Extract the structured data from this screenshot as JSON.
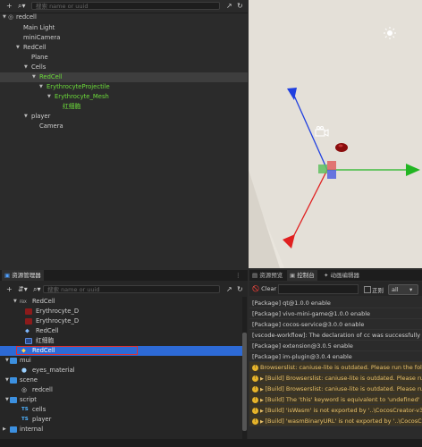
{
  "hierarchy": {
    "search_placeholder": "搜索 name or uuid",
    "add_label": "+",
    "items": [
      {
        "label": "redcell"
      },
      {
        "label": "Main Light"
      },
      {
        "label": "miniCamera"
      },
      {
        "label": "RedCell"
      },
      {
        "label": "Plane"
      },
      {
        "label": "Cells"
      },
      {
        "label": "RedCell"
      },
      {
        "label": "ErythrocyteProjectile"
      },
      {
        "label": "Erythrocyte_Mesh"
      },
      {
        "label": "红细胞"
      },
      {
        "label": "player"
      },
      {
        "label": "Camera"
      }
    ]
  },
  "assets": {
    "tab_title": "资源管理器",
    "search_placeholder": "搜索 name or uuid",
    "items": [
      {
        "label": "RedCell"
      },
      {
        "label": "Erythrocyte_D"
      },
      {
        "label": "Erythrocyte_D"
      },
      {
        "label": "RedCell"
      },
      {
        "label": "红细胞"
      },
      {
        "label": "RedCell"
      },
      {
        "label": "mui"
      },
      {
        "label": "eyes_material"
      },
      {
        "label": "scene"
      },
      {
        "label": "redcell"
      },
      {
        "label": "script"
      },
      {
        "label": "cells"
      },
      {
        "label": "player"
      },
      {
        "label": "internal"
      }
    ],
    "ts_badge": "TS"
  },
  "console": {
    "tabs": [
      "资源预览",
      "控制台",
      "动画编辑器"
    ],
    "clear_label": "Clear",
    "regex_label": "正则",
    "filter_value": "all",
    "lines": [
      {
        "text": "[Package] qt@1.0.0 enable",
        "level": "info"
      },
      {
        "text": "[Package] vivo-mini-game@1.0.0 enable",
        "level": "info"
      },
      {
        "text": "[Package] cocos-service@3.0.0 enable",
        "level": "info"
      },
      {
        "text": "[vscode-workflow]: The declaration of cc was successfully updated",
        "level": "info"
      },
      {
        "text": "[Package] extension@3.0.5 enable",
        "level": "info"
      },
      {
        "text": "[Package] im-plugin@3.0.4 enable",
        "level": "info"
      },
      {
        "text": "Browserslist: caniuse-lite is outdated. Please run the following",
        "level": "warn"
      },
      {
        "text": "[Build] Browserslist: caniuse-lite is outdated. Please run the",
        "level": "warn"
      },
      {
        "text": "[Build] Browserslist: caniuse-lite is outdated. Please run:",
        "level": "warn"
      },
      {
        "text": "[Build] The 'this' keyword is equivalent to 'undefined' at the top",
        "level": "warn"
      },
      {
        "text": "[Build] 'isWasm' is not exported by '..\\CocosCreator-v3.0.1-w",
        "level": "warn"
      },
      {
        "text": "[Build] 'wasmBinaryURL' is not exported by '..\\CocosCreator",
        "level": "warn"
      }
    ]
  },
  "colors": {
    "selection": "#2d6ad6",
    "highlight_border": "#e03030",
    "axis_x": "#22b522",
    "axis_y": "#e02020",
    "axis_z": "#2040e0"
  }
}
